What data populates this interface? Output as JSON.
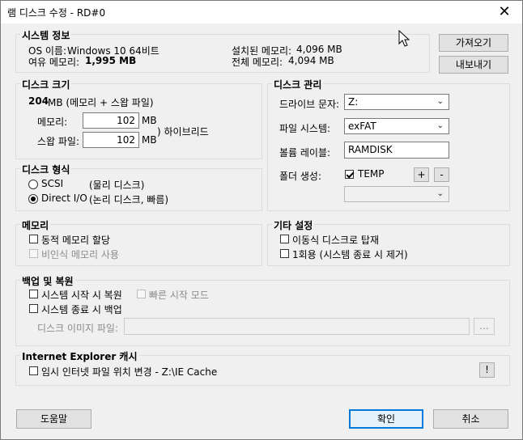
{
  "window": {
    "title": "램 디스크 수정 - RD#0",
    "close_glyph": "✕"
  },
  "system_info": {
    "title": "시스템 정보",
    "os_label": "OS 이름:",
    "os_value": "Windows 10 64비트",
    "free_mem_label": "여유 메모리:",
    "free_mem_value": "1,995 MB",
    "installed_mem_label": "설치된 메모리:",
    "installed_mem_value": "4,096 MB",
    "total_mem_label": "전체 메모리:",
    "total_mem_value": "4,094 MB"
  },
  "side_buttons": {
    "import": "가져오기",
    "export": "내보내기"
  },
  "disk_size": {
    "title": "디스크 크기",
    "total_value": "204",
    "total_unit": "MB (메모리 + 스왑 파일)",
    "memory_label": "메모리:",
    "memory_value": "102",
    "memory_unit": "MB",
    "swap_label": "스왑 파일:",
    "swap_value": "102",
    "swap_unit": "MB",
    "hybrid_label": ") 하이브리드"
  },
  "disk_mgmt": {
    "title": "디스크 관리",
    "drive_label": "드라이브 문자:",
    "drive_value": "Z:",
    "fs_label": "파일 시스템:",
    "fs_value": "exFAT",
    "volume_label": "볼륨 레이블:",
    "volume_value": "RAMDISK",
    "folder_label": "폴더 생성:",
    "folder_value": "TEMP",
    "plus": "+",
    "minus": "-",
    "folder_select_value": ""
  },
  "disk_type": {
    "title": "디스크 형식",
    "scsi_label": "SCSI",
    "scsi_desc": "(물리 디스크)",
    "directio_label": "Direct I/O",
    "directio_desc": "(논리 디스크, 빠름)"
  },
  "memory": {
    "title": "메모리",
    "dynamic_label": "동적 메모리 할당",
    "nonpaged_label": "비인식 메모리 사용"
  },
  "other": {
    "title": "기타 설정",
    "removable_label": "이동식 디스크로 탑재",
    "once_label": "1회용 (시스템 종료 시 제거)"
  },
  "backup": {
    "title": "백업 및 복원",
    "restore_label": "시스템 시작 시 복원",
    "fast_label": "빠른 시작 모드",
    "backup_label": "시스템 종료 시 백업",
    "image_label": "디스크 이미지 파일:",
    "image_value": "",
    "browse": "..."
  },
  "ie_cache": {
    "title": "Internet Explorer 캐시",
    "change_label": "임시 인터넷 파일 위치 변경 - Z:\\IE Cache",
    "info": "!"
  },
  "footer": {
    "help": "도움말",
    "ok": "확인",
    "cancel": "취소"
  }
}
